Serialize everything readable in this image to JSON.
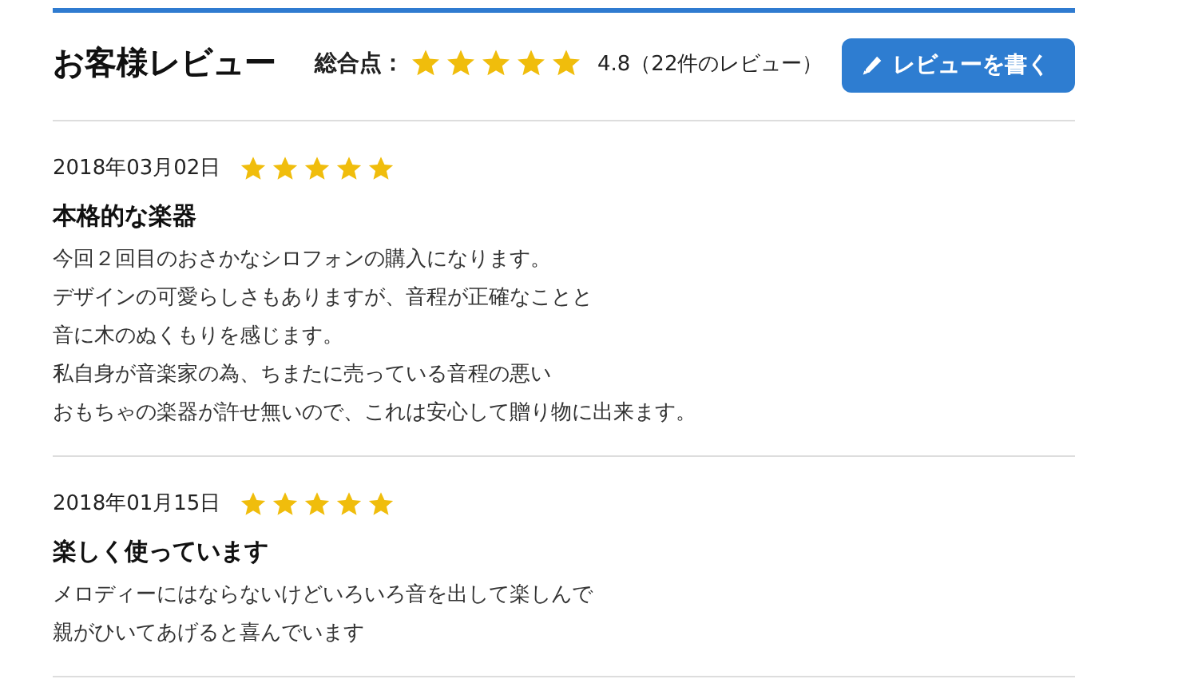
{
  "header": {
    "title": "お客様レビュー",
    "rating_label": "総合点：",
    "stars": 5,
    "rating_text": "4.8（22件のレビュー）",
    "write_button": "レビューを書く"
  },
  "reviews": [
    {
      "date": "2018年03月02日",
      "stars": 5,
      "title": "本格的な楽器",
      "lines": [
        "今回２回目のおさかなシロフォンの購入になります。",
        "デザインの可愛らしさもありますが、音程が正確なことと",
        "音に木のぬくもりを感じます。",
        "私自身が音楽家の為、ちまたに売っている音程の悪い",
        "おもちゃの楽器が許せ無いので、これは安心して贈り物に出来ます。"
      ]
    },
    {
      "date": "2018年01月15日",
      "stars": 5,
      "title": "楽しく使っています",
      "lines": [
        "メロディーにはならないけどいろいろ音を出して楽しんで",
        "親がひいてあげると喜んでいます"
      ]
    }
  ]
}
